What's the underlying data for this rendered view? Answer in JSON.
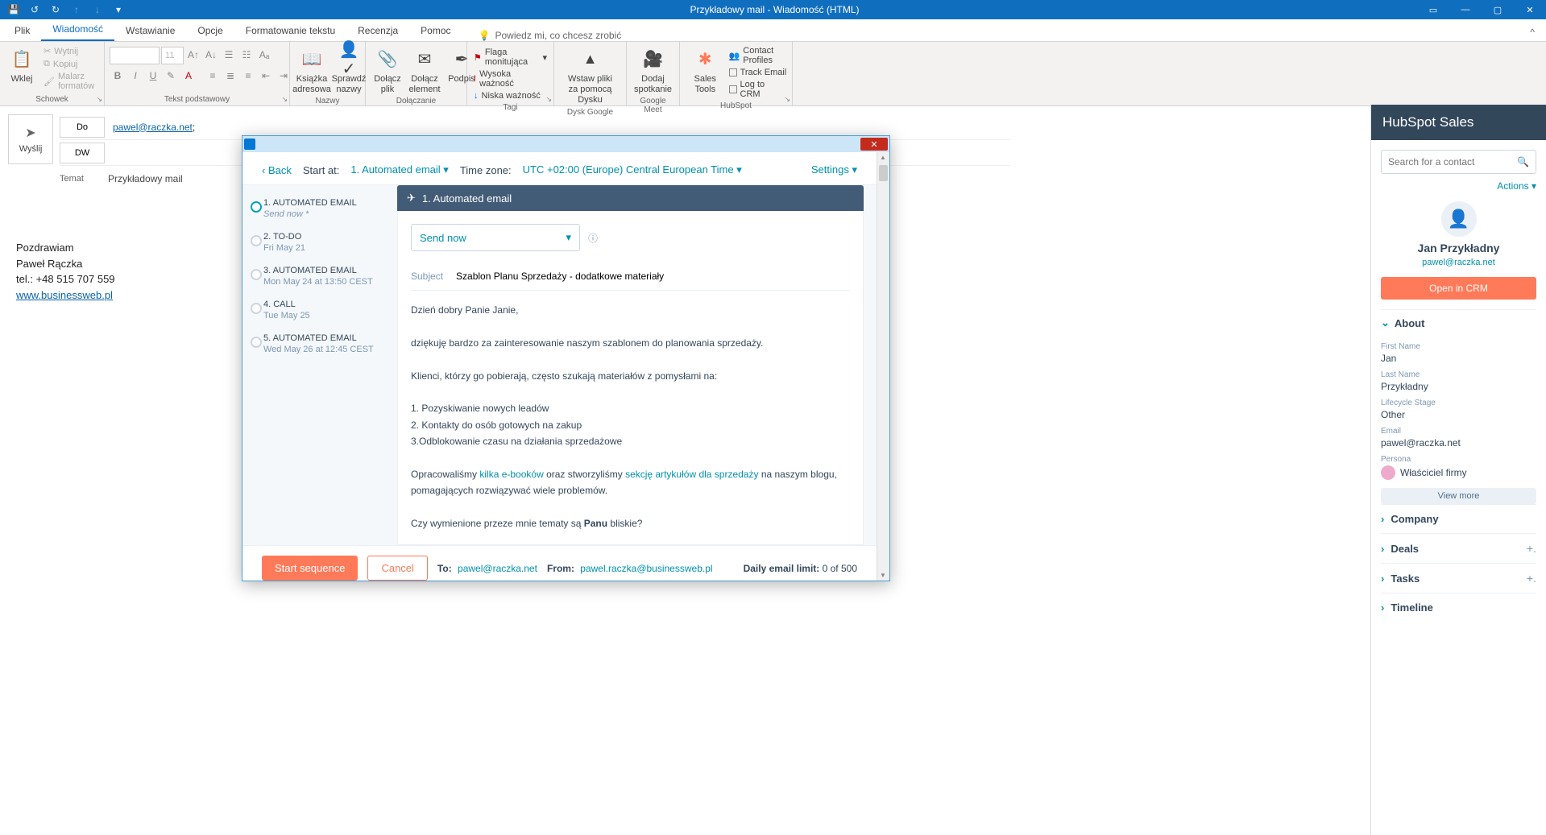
{
  "titlebar": {
    "title": "Przykładowy mail  -  Wiadomość (HTML)"
  },
  "tabs": [
    "Plik",
    "Wiadomość",
    "Wstawianie",
    "Opcje",
    "Formatowanie tekstu",
    "Recenzja",
    "Pomoc"
  ],
  "tellme": "Powiedz mi, co chcesz zrobić",
  "ribbon": {
    "clipboard": {
      "paste": "Wklej",
      "cut": "Wytnij",
      "copy": "Kopiuj",
      "formatPainter": "Malarz formatów",
      "group": "Schowek"
    },
    "font": {
      "size": "11",
      "group": "Tekst podstawowy"
    },
    "names": {
      "addrBook": "Książka adresowa",
      "checkNames": "Sprawdź nazwy",
      "group": "Nazwy"
    },
    "attach": {
      "file": "Dołącz plik",
      "item": "Dołącz element",
      "signature": "Podpis",
      "group": "Dołączanie"
    },
    "tags": {
      "followUp": "Flaga monitująca",
      "high": "Wysoka ważność",
      "low": "Niska ważność",
      "group": "Tagi"
    },
    "drive": {
      "insert": "Wstaw pliki za pomocą Dysku",
      "group": "Dysk Google"
    },
    "meet": {
      "add": "Dodaj spotkanie",
      "group": "Google Meet"
    },
    "hubspot": {
      "tools": "Sales Tools",
      "profiles": "Contact Profiles",
      "track": "Track Email",
      "log": "Log to CRM",
      "group": "HubSpot"
    }
  },
  "compose": {
    "send": "Wyślij",
    "to": "Do",
    "cc": "DW",
    "subjectLabel": "Temat",
    "toValue": "pawel@raczka.net",
    "subjectValue": "Przykładowy mail"
  },
  "signature": {
    "greeting": "Pozdrawiam",
    "name": "Paweł Rączka",
    "tel": "tel.: +48 515 707 559",
    "url": "www.businessweb.pl"
  },
  "hubspotPanel": {
    "title": "HubSpot Sales",
    "searchPlaceholder": "Search for a contact",
    "actions": "Actions",
    "contactName": "Jan Przykładny",
    "contactEmail": "pawel@raczka.net",
    "openCrm": "Open in CRM",
    "aboutLabel": "About",
    "firstNameLabel": "First Name",
    "firstName": "Jan",
    "lastNameLabel": "Last Name",
    "lastName": "Przykładny",
    "lifecycleLabel": "Lifecycle Stage",
    "lifecycle": "Other",
    "emailLabel": "Email",
    "email": "pawel@raczka.net",
    "personaLabel": "Persona",
    "persona": "Właściciel firmy",
    "viewMore": "View more",
    "sections": [
      "Company",
      "Deals",
      "Tasks",
      "Timeline"
    ]
  },
  "dialog": {
    "back": "Back",
    "startAtLabel": "Start at:",
    "startAtValue": "1. Automated email",
    "tzLabel": "Time zone:",
    "tzValue": "UTC +02:00 (Europe) Central European Time",
    "settings": "Settings",
    "steps": [
      {
        "title": "1. AUTOMATED EMAIL",
        "sub": "Send now *"
      },
      {
        "title": "2. TO-DO",
        "sub": "Fri May 21"
      },
      {
        "title": "3. AUTOMATED EMAIL",
        "sub": "Mon May 24 at 13:50 CEST"
      },
      {
        "title": "4. CALL",
        "sub": "Tue May 25"
      },
      {
        "title": "5. AUTOMATED EMAIL",
        "sub": "Wed May 26 at 12:45 CEST"
      }
    ],
    "stepHeader": "1. Automated email",
    "sendNow": "Send now",
    "subjectLabel": "Subject",
    "subject": "Szablon Planu Sprzedaży - dodatkowe materiały",
    "body": {
      "l1": "Dzień dobry Panie Janie,",
      "l2": "dziękuję bardzo za zainteresowanie naszym szablonem do planowania sprzedaży.",
      "l3": "Klienci, którzy go pobierają, często szukają materiałów z pomysłami na:",
      "li1": "1. Pozyskiwanie nowych leadów",
      "li2": "2. Kontakty do osób gotowych na zakup",
      "li3": "3.Odblokowanie czasu na działania sprzedażowe",
      "l4a": "Opracowaliśmy ",
      "link1": "kilka e-booków",
      "l4b": "  oraz stworzyliśmy ",
      "link2": "sekcję artykułów dla sprzedaży",
      "l4c": " na naszym blogu, pomagających rozwiązywać wiele problemów.",
      "l5a": "Czy wymienione przeze mnie tematy są ",
      "l5b": "Panu",
      "l5c": " bliskie?"
    },
    "startSeq": "Start sequence",
    "cancel": "Cancel",
    "toLabel": "To:",
    "toValue": "pawel@raczka.net",
    "fromLabel": "From:",
    "fromValue": "pawel.raczka@businessweb.pl",
    "dailyLabel": "Daily email limit:",
    "dailyValue": "0 of 500"
  }
}
